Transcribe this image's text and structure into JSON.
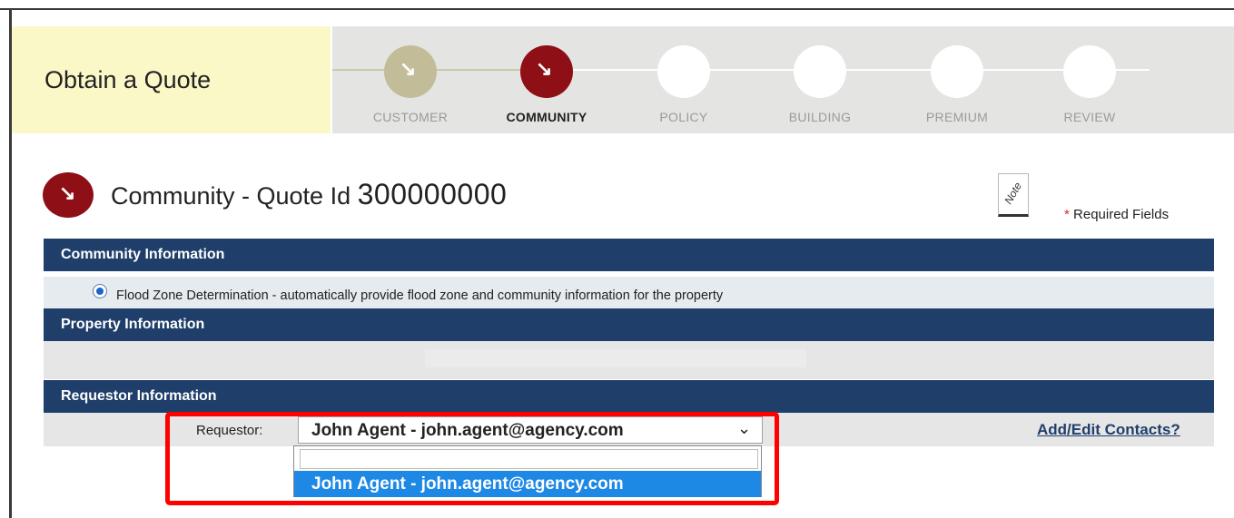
{
  "header": {
    "title": "Obtain a Quote"
  },
  "steps": [
    {
      "label": "CUSTOMER",
      "state": "done",
      "icon": "arrow-down-right-icon"
    },
    {
      "label": "COMMUNITY",
      "state": "current",
      "icon": "arrow-down-right-icon"
    },
    {
      "label": "POLICY",
      "state": "pending"
    },
    {
      "label": "BUILDING",
      "state": "pending"
    },
    {
      "label": "PREMIUM",
      "state": "pending"
    },
    {
      "label": "REVIEW",
      "state": "pending"
    }
  ],
  "page": {
    "title_prefix": "Community - Quote Id",
    "quote_id": "300000000",
    "note_label": "Note",
    "required_star": "*",
    "required_label": "Required Fields"
  },
  "sections": {
    "community": "Community Information",
    "property": "Property Information",
    "requestor": "Requestor Information"
  },
  "community": {
    "option_label": "Flood Zone Determination - automatically provide flood zone and community information for the property",
    "selected": true
  },
  "requestor": {
    "label": "Requestor:",
    "selected_value": "John Agent - john.agent@agency.com",
    "dropdown_options": [
      "",
      "John Agent - john.agent@agency.com"
    ],
    "add_edit_link": "Add/Edit Contacts?"
  },
  "colors": {
    "brand_dark_red": "#8e0f16",
    "done_step": "#c2bd98",
    "section_bar": "#1f3f6a",
    "title_bg": "#fbf8c8",
    "option_highlight": "#1e88e5",
    "annotation_red": "#ff0000"
  }
}
